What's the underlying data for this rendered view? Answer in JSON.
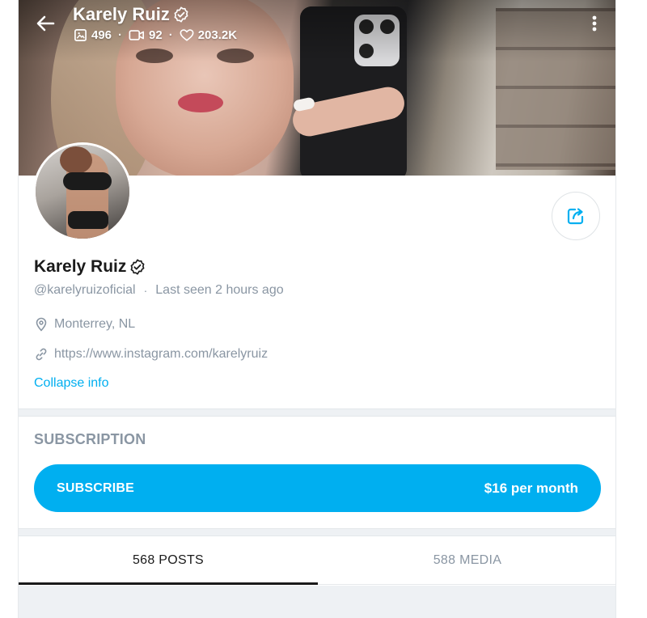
{
  "header": {
    "name": "Karely Ruiz",
    "stats": {
      "images": "496",
      "videos": "92",
      "likes": "203.2K"
    },
    "stat_separator": "·"
  },
  "profile": {
    "name": "Karely Ruiz",
    "handle": "@karelyruizoficial",
    "separator": "·",
    "last_seen": "Last seen 2 hours ago",
    "location": "Monterrey, NL",
    "link": "https://www.instagram.com/karelyruiz",
    "collapse_label": "Collapse info"
  },
  "subscription": {
    "title": "SUBSCRIPTION",
    "button_label": "SUBSCRIBE",
    "price": "$16 per month"
  },
  "tabs": [
    {
      "label": "568 POSTS",
      "active": true
    },
    {
      "label": "588 MEDIA",
      "active": false
    }
  ],
  "colors": {
    "accent": "#00aff0",
    "muted": "#8a96a3",
    "text": "#1a1a1a"
  },
  "icons": {
    "back": "arrow-left-icon",
    "menu": "kebab-menu-icon",
    "verified": "verified-badge-icon",
    "images": "image-icon",
    "videos": "video-icon",
    "likes": "heart-icon",
    "share": "share-icon",
    "location": "location-pin-icon",
    "link": "link-icon"
  }
}
